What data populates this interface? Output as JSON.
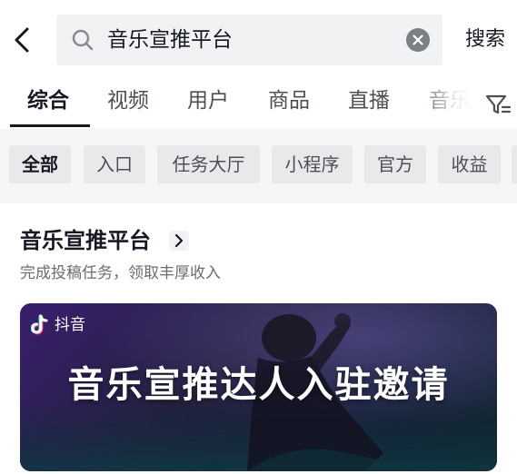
{
  "search": {
    "query": "音乐宣推平台",
    "submit_label": "搜索"
  },
  "tabs": [
    {
      "label": "综合",
      "active": true
    },
    {
      "label": "视频",
      "active": false
    },
    {
      "label": "用户",
      "active": false
    },
    {
      "label": "商品",
      "active": false
    },
    {
      "label": "直播",
      "active": false
    },
    {
      "label": "音乐",
      "active": false
    }
  ],
  "chips": [
    {
      "label": "全部",
      "active": true
    },
    {
      "label": "入口",
      "active": false
    },
    {
      "label": "任务大厅",
      "active": false
    },
    {
      "label": "小程序",
      "active": false
    },
    {
      "label": "官方",
      "active": false
    },
    {
      "label": "收益",
      "active": false
    }
  ],
  "result": {
    "title": "音乐宣推平台",
    "description": "完成投稿任务，领取丰厚收入",
    "banner": {
      "brand": "抖音",
      "headline": "音乐宣推达人入驻邀请"
    }
  },
  "icons": {
    "back": "chevron-left-icon",
    "search": "search-icon",
    "clear": "close-circle-icon",
    "filter": "filter-icon",
    "chevron": "chevron-right-icon",
    "logo": "douyin-logo"
  },
  "colors": {
    "text_primary": "#161823",
    "text_secondary": "#6a6c73",
    "chip_bg": "#e9e9ec",
    "search_bg": "#f1f2f4",
    "chips_bar_bg": "#f5f5f7"
  }
}
